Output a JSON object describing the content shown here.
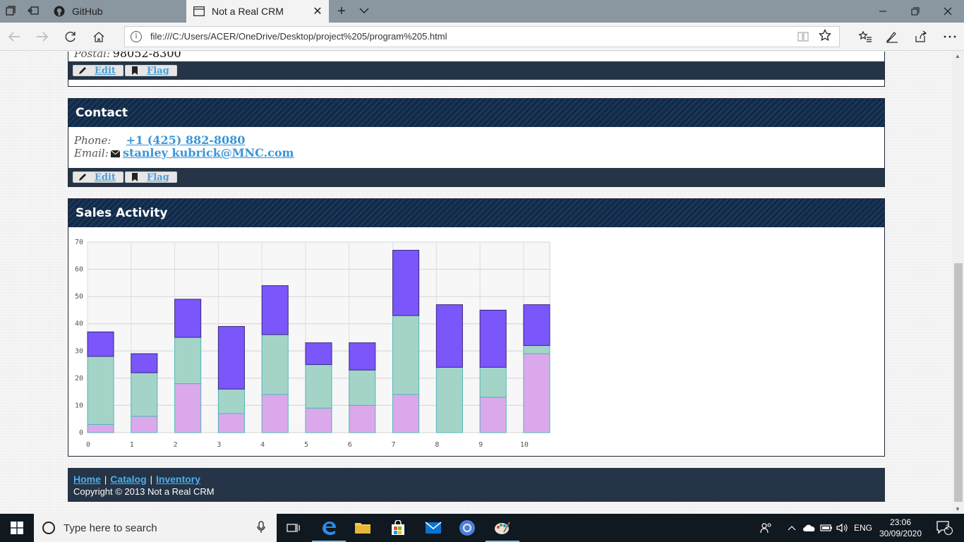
{
  "browser": {
    "tabs": [
      {
        "label": "GitHub",
        "icon": "github-icon"
      },
      {
        "label": "Not a Real CRM",
        "icon": "page-icon"
      }
    ],
    "url": "file:///C:/Users/ACER/OneDrive/Desktop/project%205/program%205.html"
  },
  "address_panel": {
    "postal_label": "Postal:",
    "postal_value": "98052-8300",
    "edit_label": "Edit",
    "flag_label": "Flag"
  },
  "contact_panel": {
    "title": "Contact",
    "phone_label": "Phone:",
    "phone_value": "+1 (425) 882-8080",
    "email_label": "Email:",
    "email_value": "stanley kubrick@MNC.com",
    "edit_label": "Edit",
    "flag_label": "Flag"
  },
  "sales_panel": {
    "title": "Sales Activity"
  },
  "chart_data": {
    "type": "bar",
    "stacked": true,
    "categories": [
      "0",
      "1",
      "2",
      "3",
      "4",
      "5",
      "6",
      "7",
      "8",
      "9",
      "10"
    ],
    "series": [
      {
        "color": "#dca8ec",
        "values": [
          3,
          6,
          18,
          7,
          14,
          9,
          10,
          14,
          0,
          13,
          29
        ]
      },
      {
        "color": "#a4d4c8",
        "values": [
          25,
          16,
          17,
          9,
          22,
          16,
          13,
          29,
          24,
          11,
          3
        ]
      },
      {
        "color": "#7b56fa",
        "values": [
          9,
          7,
          14,
          23,
          18,
          8,
          10,
          24,
          23,
          21,
          15
        ]
      }
    ],
    "ylim": [
      0,
      70
    ],
    "yticks": [
      0,
      10,
      20,
      30,
      40,
      50,
      60,
      70
    ],
    "grid": true
  },
  "footer": {
    "links": [
      "Home",
      "Catalog",
      "Inventory"
    ],
    "separator": "|",
    "copyright": "Copyright © 2013 Not a Real CRM"
  },
  "taskbar": {
    "search_placeholder": "Type here to search",
    "language": "ENG",
    "time": "23:06",
    "date": "30/09/2020",
    "notification_count": "2"
  }
}
